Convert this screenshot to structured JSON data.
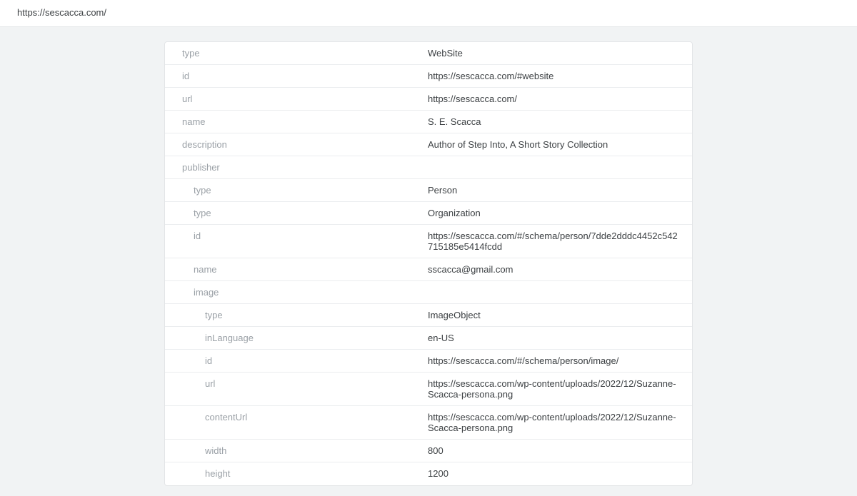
{
  "header": {
    "url": "https://sescacca.com/"
  },
  "rows": [
    {
      "indent": 0,
      "label": "type",
      "value": "WebSite"
    },
    {
      "indent": 0,
      "label": "id",
      "value": "https://sescacca.com/#website"
    },
    {
      "indent": 0,
      "label": "url",
      "value": "https://sescacca.com/"
    },
    {
      "indent": 0,
      "label": "name",
      "value": "S. E. Scacca"
    },
    {
      "indent": 0,
      "label": "description",
      "value": "Author of Step Into, A Short Story Collection"
    },
    {
      "indent": 0,
      "label": "publisher",
      "value": ""
    },
    {
      "indent": 1,
      "label": "type",
      "value": "Person"
    },
    {
      "indent": 1,
      "label": "type",
      "value": "Organization"
    },
    {
      "indent": 1,
      "label": "id",
      "value": "https://sescacca.com/#/schema/person/7dde2dddc4452c542715185e5414fcdd"
    },
    {
      "indent": 1,
      "label": "name",
      "value": "sscacca@gmail.com"
    },
    {
      "indent": 1,
      "label": "image",
      "value": ""
    },
    {
      "indent": 2,
      "label": "type",
      "value": "ImageObject"
    },
    {
      "indent": 2,
      "label": "inLanguage",
      "value": "en-US"
    },
    {
      "indent": 2,
      "label": "id",
      "value": "https://sescacca.com/#/schema/person/image/"
    },
    {
      "indent": 2,
      "label": "url",
      "value": "https://sescacca.com/wp-content/uploads/2022/12/Suzanne-Scacca-persona.png"
    },
    {
      "indent": 2,
      "label": "contentUrl",
      "value": "https://sescacca.com/wp-content/uploads/2022/12/Suzanne-Scacca-persona.png"
    },
    {
      "indent": 2,
      "label": "width",
      "value": "800"
    },
    {
      "indent": 2,
      "label": "height",
      "value": "1200"
    }
  ]
}
